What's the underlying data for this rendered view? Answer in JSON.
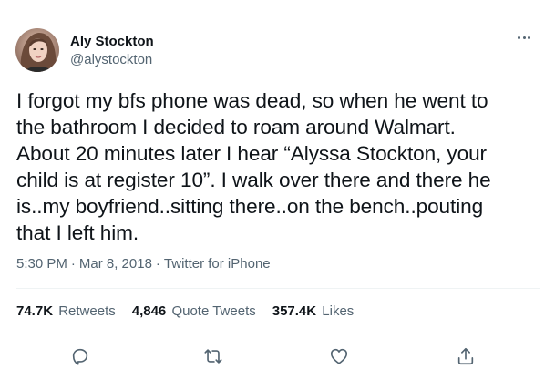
{
  "tweet": {
    "author": {
      "display_name": "Aly Stockton",
      "handle": "@alystockton"
    },
    "text_lines": [
      "I forgot my bfs phone was dead, so when he went to",
      "the bathroom I decided to roam around Walmart.",
      "About 20 minutes later I hear “Alyssa Stockton, your",
      "child is at register 10”. I walk over there and there he",
      "is..my boyfriend..sitting there..on the bench..pouting",
      "that I left him."
    ],
    "time": "5:30 PM",
    "date": "Mar 8, 2018",
    "separator": "·",
    "source": "Twitter for iPhone",
    "stats": {
      "retweets_count": "74.7K",
      "retweets_label": "Retweets",
      "quote_count": "4,846",
      "quote_label": "Quote Tweets",
      "likes_count": "357.4K",
      "likes_label": "Likes"
    },
    "icons": {
      "more": "more-dots-icon",
      "reply": "reply-icon",
      "retweet": "retweet-icon",
      "like": "heart-icon",
      "share": "share-icon"
    },
    "colors": {
      "text": "#0f1419",
      "secondary": "#536471",
      "divider": "#eff3f4"
    }
  }
}
